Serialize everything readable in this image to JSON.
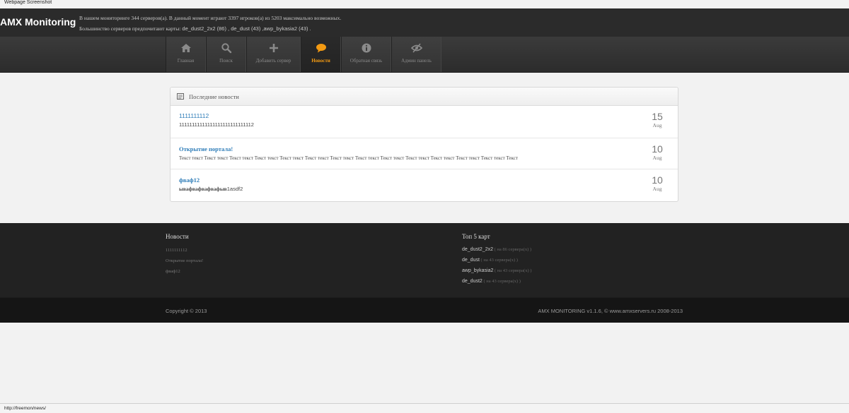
{
  "screenshot_label": "Webpage Screenshot",
  "header": {
    "brand": "AMX Monitoring",
    "stats_line1": "В нашем мониторинге 344 серверов(а). В данный момент играют 3397 игроков(а) из 5203 максимально возможных.",
    "stats_line2_prefix": "Большинство серверов предпочитают карты:",
    "stats_line2_maps": " de_dust2_2x2 (86) , de_dust (43) ,awp_bykasia2 (43) ."
  },
  "nav": [
    {
      "label": "Главная",
      "icon": "home-icon"
    },
    {
      "label": "Поиск",
      "icon": "search-icon"
    },
    {
      "label": "Добавить сервер",
      "icon": "plus-icon"
    },
    {
      "label": "Новости",
      "icon": "speech-bubble-icon",
      "active": true
    },
    {
      "label": "Обратная связь",
      "icon": "info-icon"
    },
    {
      "label": "Админ панель",
      "icon": "eye-slash-icon"
    }
  ],
  "colors": {
    "accent": "#f39a12",
    "link": "#2f7db8",
    "footer_bg": "#222222"
  },
  "news_panel": {
    "title": "Последние новости",
    "items": [
      {
        "title": "1111111112",
        "body": "11111111111111111111111111112",
        "day": "15",
        "month": "Aug"
      },
      {
        "title": "Открытие портала!",
        "body": "Текст текст Текст текст Текст текст Текст текст Текст текст Текст текст Текст текст Текст текст Текст текст Текст текст Текст текст Текст текст Текст текст Текст",
        "day": "10",
        "month": "Aug"
      },
      {
        "title": "фваф12",
        "body_serif": "ывафвафвафвафыв",
        "body_sans": "1asdf2",
        "day": "10",
        "month": "Aug"
      }
    ]
  },
  "footer": {
    "news_title": "Новости",
    "news_links": [
      "1111111112",
      "Открытие портала!",
      "фваф12"
    ],
    "maps_title": "Топ 5 карт",
    "maps": [
      {
        "name": "de_dust2_2x2",
        "count": " ( на 86 сервера(х) )"
      },
      {
        "name": "de_dust",
        "count": " ( на 43 сервера(х) )"
      },
      {
        "name": "awp_bykasia2",
        "count": " ( на 43 сервера(х) )"
      },
      {
        "name": "de_dust2",
        "count": " ( на 43 сервера(х) )"
      }
    ],
    "copyright": "Copyright © 2013",
    "credits": "AMX MONITORING v1.1.6, © www.amxservers.ru 2008-2013"
  },
  "status_url": "http://freemon/news/"
}
